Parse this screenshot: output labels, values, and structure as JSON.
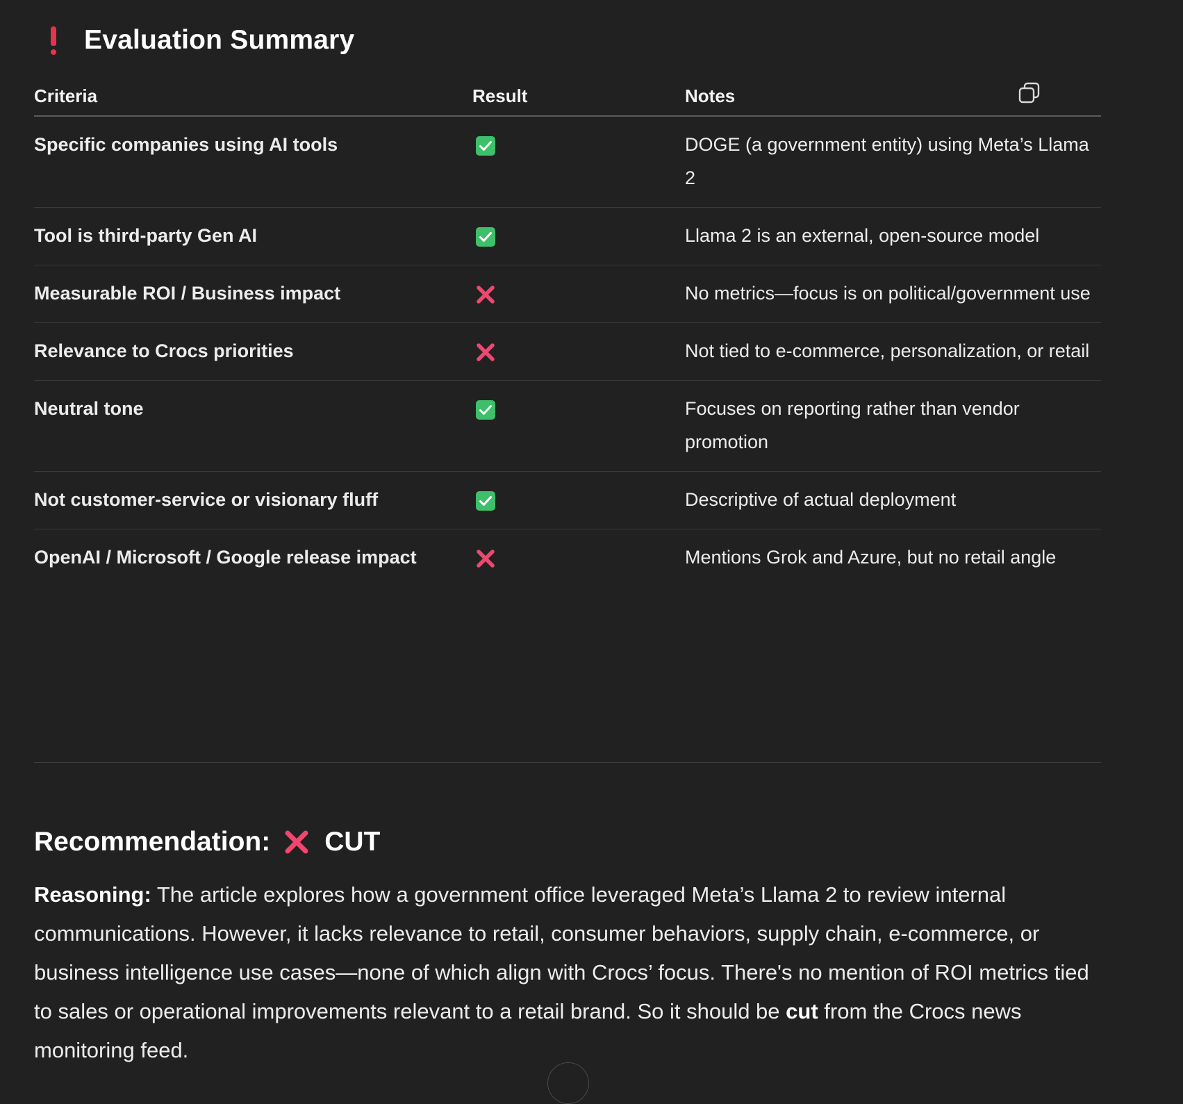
{
  "title": "Evaluation Summary",
  "table": {
    "headers": {
      "criteria": "Criteria",
      "result": "Result",
      "notes": "Notes"
    },
    "rows": [
      {
        "criteria": "Specific companies using AI tools",
        "result": "pass",
        "notes": "DOGE (a government entity) using Meta’s Llama 2"
      },
      {
        "criteria": "Tool is third-party Gen AI",
        "result": "pass",
        "notes": "Llama 2 is an external, open-source model"
      },
      {
        "criteria": "Measurable ROI / Business impact",
        "result": "fail",
        "notes": "No metrics—focus is on political/government use"
      },
      {
        "criteria": "Relevance to Crocs priorities",
        "result": "fail",
        "notes": "Not tied to e-commerce, personalization, or retail"
      },
      {
        "criteria": "Neutral tone",
        "result": "pass",
        "notes": "Focuses on reporting rather than vendor promotion"
      },
      {
        "criteria": "Not customer-service or visionary fluff",
        "result": "pass",
        "notes": "Descriptive of actual deployment"
      },
      {
        "criteria": "OpenAI / Microsoft / Google release impact",
        "result": "fail",
        "notes": "Mentions Grok and Azure, but no retail angle"
      }
    ]
  },
  "recommendation": {
    "label": "Recommendation:",
    "verdict": "CUT"
  },
  "reasoning": {
    "label": "Reasoning:",
    "text_before": " The article explores how a government office leveraged Meta’s Llama 2 to review internal communications. However, it lacks relevance to retail, consumer behaviors, supply chain, e-commerce, or business intelligence use cases—none of which align with Crocs’ focus. There's no mention of ROI metrics tied to sales or operational improvements relevant to a retail brand. So it should be ",
    "emphasis": "cut",
    "text_after": " from the Crocs news monitoring feed."
  },
  "icons": {
    "heading": "exclamation-icon",
    "copy": "copy-icon",
    "pass": "check-mark-icon",
    "fail": "cross-mark-icon",
    "scroll": "scroll-down-icon"
  },
  "colors": {
    "background": "#212121",
    "pass": "#3ebf6a",
    "fail": "#f2466e",
    "exclamation": "#e8334a"
  }
}
